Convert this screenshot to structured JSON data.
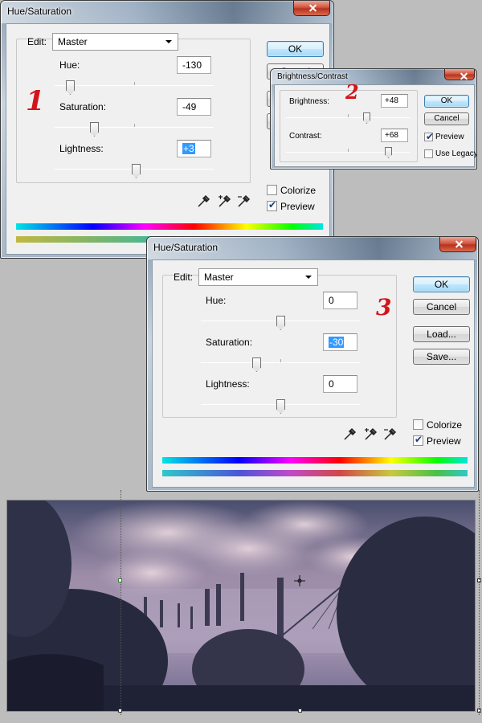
{
  "dialog1": {
    "title": "Hue/Saturation",
    "edit_label": "Edit:",
    "edit_value": "Master",
    "hue_label": "Hue:",
    "hue_value": "-130",
    "saturation_label": "Saturation:",
    "saturation_value": "-49",
    "lightness_label": "Lightness:",
    "lightness_value": "+3",
    "ok_label": "OK",
    "cancel_label": "Cancel",
    "colorize_label": "Colorize",
    "preview_label": "Preview",
    "colorize_checked": false,
    "preview_checked": true,
    "annotation": "1"
  },
  "dialog2": {
    "title": "Brightness/Contrast",
    "brightness_label": "Brightness:",
    "brightness_value": "+48",
    "contrast_label": "Contrast:",
    "contrast_value": "+68",
    "ok_label": "OK",
    "cancel_label": "Cancel",
    "preview_label": "Preview",
    "legacy_label": "Use Legacy",
    "preview_checked": true,
    "legacy_checked": false,
    "annotation": "2"
  },
  "dialog3": {
    "title": "Hue/Saturation",
    "edit_label": "Edit:",
    "edit_value": "Master",
    "hue_label": "Hue:",
    "hue_value": "0",
    "saturation_label": "Saturation:",
    "saturation_value": "-30",
    "lightness_label": "Lightness:",
    "lightness_value": "0",
    "ok_label": "OK",
    "cancel_label": "Cancel",
    "load_label": "Load...",
    "save_label": "Save...",
    "colorize_label": "Colorize",
    "preview_label": "Preview",
    "colorize_checked": false,
    "preview_checked": true,
    "annotation": "3"
  },
  "icons": [
    "close-icon",
    "eyedropper-icon",
    "eyedropper-plus-icon",
    "eyedropper-minus-icon",
    "chevron-down-icon",
    "checkmark-icon"
  ],
  "colors": {
    "selection": "#3399ff",
    "annotation_red": "#d4141a",
    "close_red": "#c8432a"
  }
}
